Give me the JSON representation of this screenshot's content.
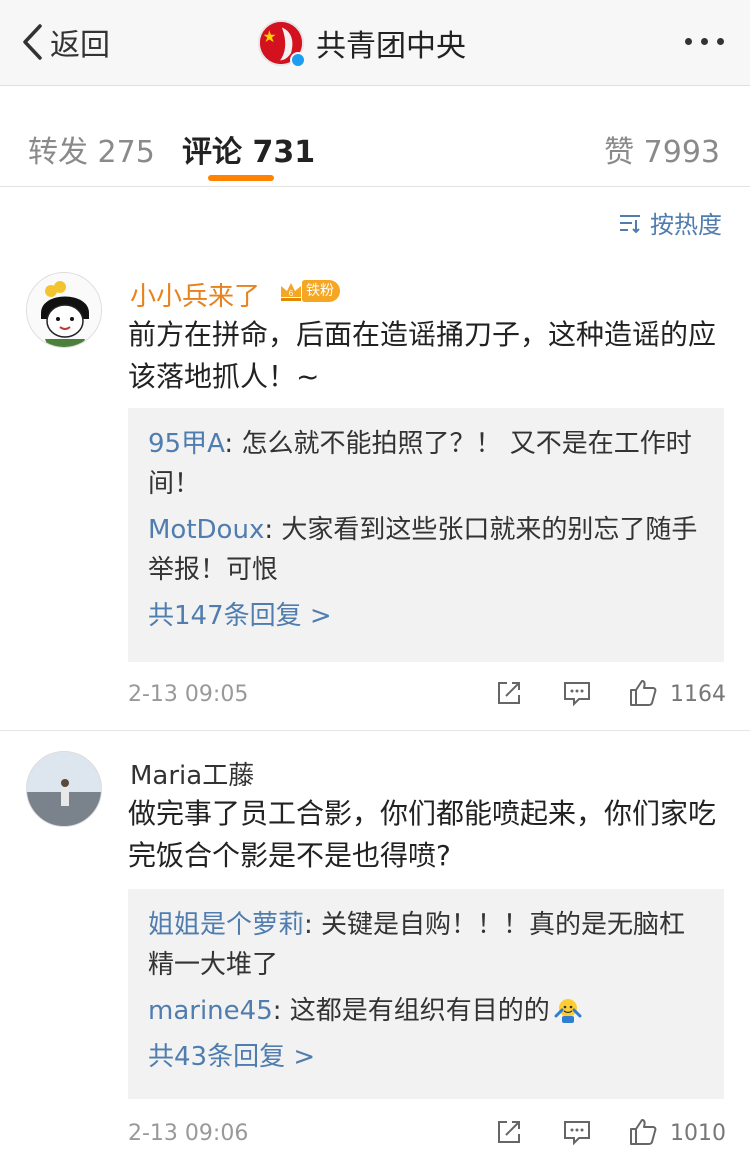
{
  "navbar": {
    "back_label": "返回",
    "title": "共青团中央"
  },
  "tabs": {
    "repost": "转发 275",
    "comment": "评论 731",
    "like": "赞 7993"
  },
  "sort_label": "按热度",
  "accent_color": "#ff8200",
  "link_color": "#507daf",
  "comments": [
    {
      "username": "小小兵来了",
      "badge": "铁粉",
      "text": "前方在拼命，后面在造谣捅刀子，这种造谣的应该落地抓人！~",
      "replies": [
        {
          "name": "95甲A",
          "text": "怎么就不能拍照了？！ 又不是在工作时间！"
        },
        {
          "name": "MotDoux",
          "text": "大家看到这些张口就来的别忘了随手举报！可恨"
        }
      ],
      "reply_more": "共147条回复 >",
      "time": "2-13 09:05",
      "likes": "1164"
    },
    {
      "username": "Maria工藤",
      "text": "做完事了员工合影，你们都能喷起来，你们家吃完饭合个影是不是也得喷?",
      "replies": [
        {
          "name": "姐姐是个萝莉",
          "text": "关键是自购！！！真的是无脑杠精一大堆了"
        },
        {
          "name": "marine45",
          "text": "这都是有组织有目的的"
        }
      ],
      "reply_more": "共43条回复 >",
      "time": "2-13 09:06",
      "likes": "1010"
    }
  ]
}
